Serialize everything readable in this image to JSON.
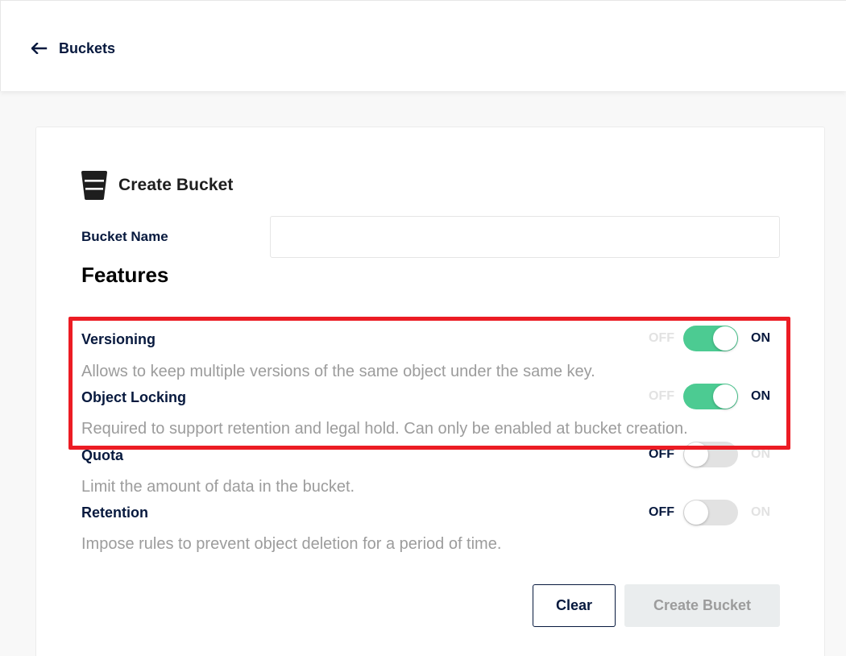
{
  "header": {
    "back_label": "Buckets"
  },
  "form": {
    "title": "Create Bucket",
    "bucket_name_label": "Bucket Name",
    "bucket_name_value": "",
    "features_heading": "Features",
    "toggle_off_label": "OFF",
    "toggle_on_label": "ON",
    "features": [
      {
        "title": "Versioning",
        "description": "Allows to keep multiple versions of the same object under the same key.",
        "enabled": true
      },
      {
        "title": "Object Locking",
        "description": "Required to support retention and legal hold. Can only be enabled at bucket creation.",
        "enabled": true
      },
      {
        "title": "Quota",
        "description": "Limit the amount of data in the bucket.",
        "enabled": false
      },
      {
        "title": "Retention",
        "description": "Impose rules to prevent object deletion for a period of time.",
        "enabled": false
      }
    ],
    "clear_label": "Clear",
    "create_label": "Create Bucket"
  },
  "colors": {
    "primary_text": "#07193e",
    "toggle_on": "#4ccb92",
    "toggle_off": "#e2e2e2",
    "highlight": "#ec1c24",
    "muted_text": "#9c9c9c"
  },
  "icons": {
    "back": "arrow-left-icon",
    "bucket": "bucket-icon"
  }
}
